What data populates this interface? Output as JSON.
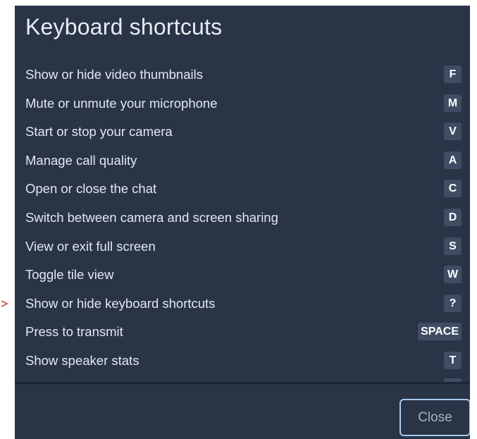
{
  "dialog": {
    "title": "Keyboard shortcuts",
    "close_label": "Close"
  },
  "shortcuts": [
    {
      "label": "Show or hide video thumbnails",
      "key": "F"
    },
    {
      "label": "Mute or unmute your microphone",
      "key": "M"
    },
    {
      "label": "Start or stop your camera",
      "key": "V"
    },
    {
      "label": "Manage call quality",
      "key": "A"
    },
    {
      "label": "Open or close the chat",
      "key": "C"
    },
    {
      "label": "Switch between camera and screen sharing",
      "key": "D"
    },
    {
      "label": "View or exit full screen",
      "key": "S"
    },
    {
      "label": "Toggle tile view",
      "key": "W"
    },
    {
      "label": "Show or hide keyboard shortcuts",
      "key": "?"
    },
    {
      "label": "Press to transmit",
      "key": "SPACE"
    },
    {
      "label": "Show speaker stats",
      "key": "T"
    }
  ],
  "colors": {
    "dialog_background": "#293447",
    "key_badge": "#3f4d63",
    "close_border": "#a8c9ee",
    "pointer_arrow": "#d9342b"
  }
}
